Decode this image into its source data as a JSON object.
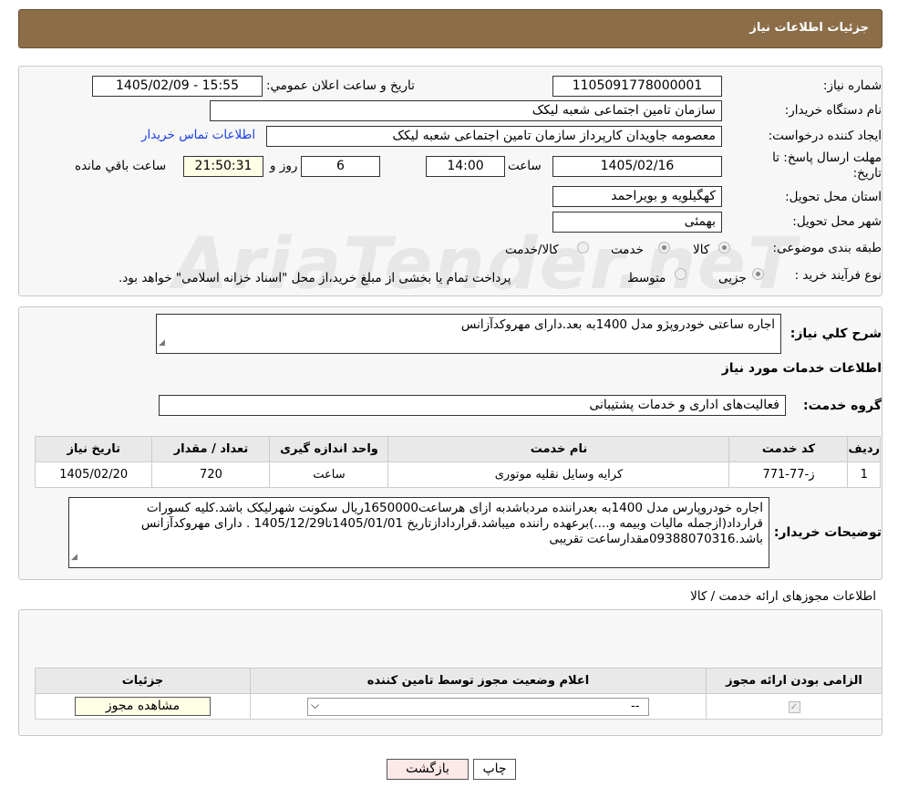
{
  "header": {
    "title": "جزئیات اطلاعات نیاز"
  },
  "watermark": "AriaTender.neT",
  "fields": {
    "need_number_label": "شماره نیاز:",
    "need_number": "1105091778000001",
    "announce_label": "تاریخ و ساعت اعلان عمومي:",
    "announce_value": "1405/02/09 - 15:55",
    "buyer_org_label": "نام دستگاه خریدار:",
    "buyer_org": "سازمان تامین اجتماعی شعبه لیکک",
    "creator_label": "ایجاد کننده درخواست:",
    "creator": "معصومه جاویدان کارپرداز سازمان تامین اجتماعی شعبه لیکک",
    "contact_link": "اطلاعات تماس خریدار",
    "deadline_label": "مهلت ارسال پاسخ: تا تاریخ:",
    "deadline_date": "1405/02/16",
    "time_label": "ساعت",
    "deadline_time": "14:00",
    "days": "6",
    "day_label": "روز و",
    "remaining_time": "21:50:31",
    "remaining_label": "ساعت باقي مانده",
    "province_label": "استان محل تحویل:",
    "province": "کهگیلویه و بویراحمد",
    "city_label": "شهر محل تحویل:",
    "city": "بهمئی",
    "category_label": "طبقه بندی موضوعی:",
    "category_options": [
      "کالا",
      "خدمت",
      "کالا/خدمت"
    ],
    "process_label": "نوع فرآیند خرید :",
    "process_options": [
      "جزیی",
      "متوسط"
    ],
    "process_note": "پرداخت تمام یا بخشی از مبلغ خرید،از محل \"اسناد خزانه اسلامی\" خواهد بود."
  },
  "summary": {
    "label": "شرح کلي نیاز:",
    "text": "اجاره ساعتی خودروپژو مدل 1400به بعد.دارای  مهروکدآزانس",
    "services_title": "اطلاعات خدمات مورد نیاز",
    "group_label": "گروه خدمت:",
    "group_value": "فعالیت‌های اداری و خدمات پشتیبانی"
  },
  "service_table": {
    "headers": [
      "ردیف",
      "کد خدمت",
      "نام خدمت",
      "واحد اندازه گیری",
      "تعداد / مقدار",
      "تاریخ نیاز"
    ],
    "rows": [
      [
        "1",
        "ز-77-771",
        "کرایه وسایل نقلیه موتوری",
        "ساعت",
        "720",
        "1405/02/20"
      ]
    ]
  },
  "buyer_notes": {
    "label": "توضیحات خریدار:",
    "text": "اجاره خودروپارس مدل 1400به بعدراننده مردباشدبه ازای هرساعت1650000ریال سکونت شهرلیکک باشد.کلیه کسورات قرارداد(ازجمله مالیات وبیمه و....)برعهده راننده میباشد.قراردادازتاریخ 1405/01/01تا1405/12/29 . دارای مهروکدآزانس باشد.09388070316مقدارساعت تقریبی"
  },
  "permits": {
    "title": "اطلاعات مجوزهای ارائه خدمت / کالا",
    "headers": [
      "الزامی بودن ارائه مجوز",
      "اعلام وضعیت مجوز توسط تامین کننده",
      "جزئیات"
    ],
    "select_value": "--",
    "view_button": "مشاهده مجوز"
  },
  "buttons": {
    "print": "چاپ",
    "back": "بازگشت"
  }
}
